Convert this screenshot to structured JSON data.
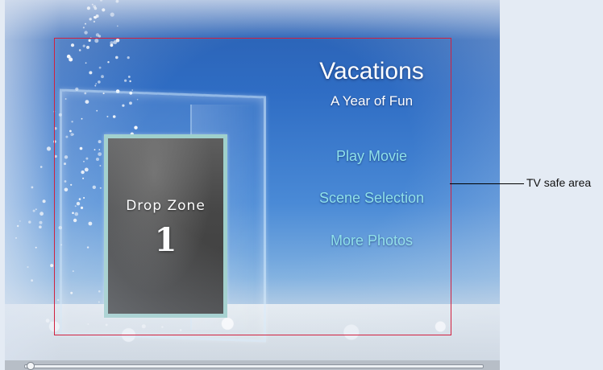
{
  "menu": {
    "title": "Vacations",
    "subtitle": "A Year of Fun",
    "buttons": [
      "Play Movie",
      "Scene Selection",
      "More Photos"
    ]
  },
  "drop_zone": {
    "label": "Drop Zone",
    "number": "1"
  },
  "annotation": {
    "label": "TV safe area",
    "color": "#d1213f"
  },
  "colors": {
    "button_text": "#8fe0ea",
    "drop_zone_border": "#9fd0cc"
  }
}
